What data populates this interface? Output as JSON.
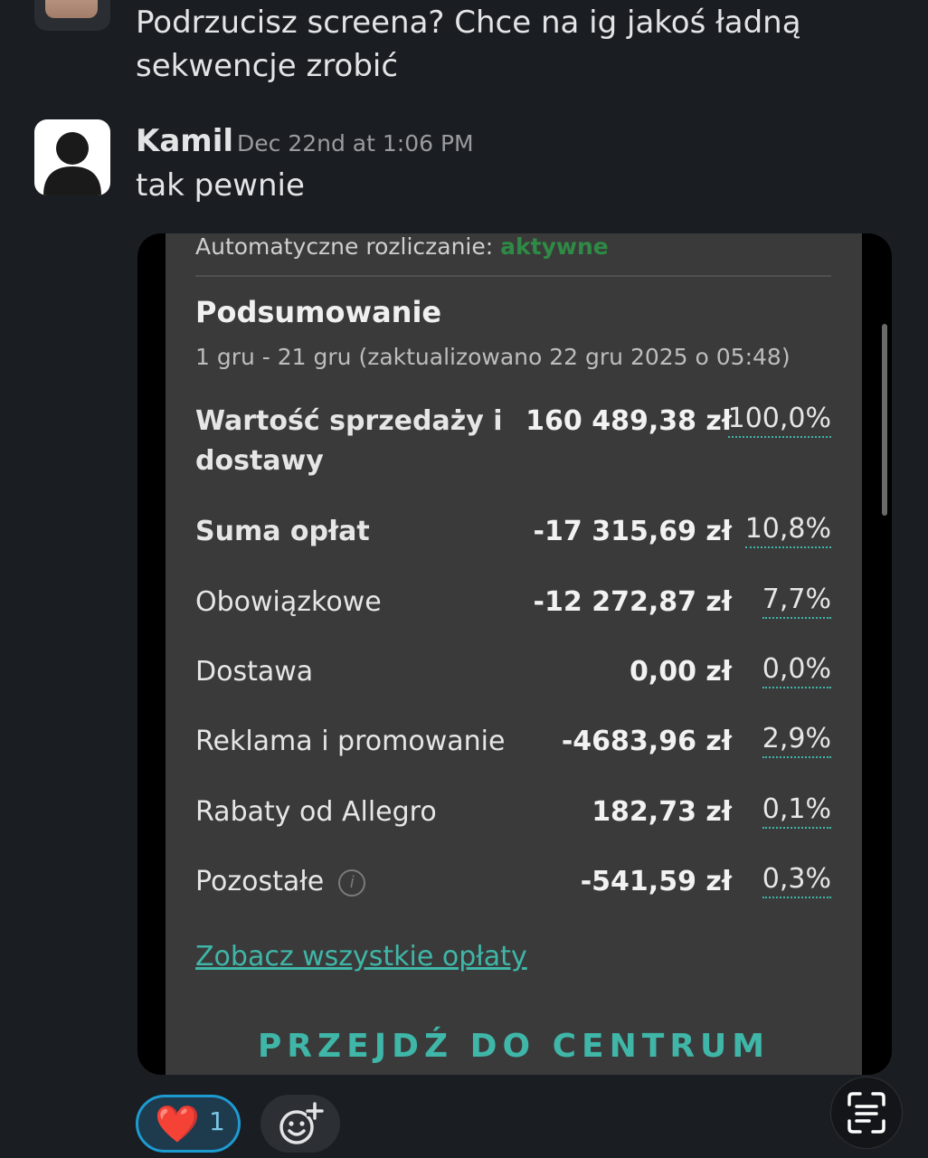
{
  "previous_message": {
    "line1": "Podrzucisz screena? Chce na ig jakoś ładną",
    "line2": "sekwencje zrobić"
  },
  "message": {
    "sender": "Kamil",
    "timestamp": "Dec 22nd at 1:06 PM",
    "text": "tak pewnie"
  },
  "screenshot": {
    "auto_label": "Automatyczne rozliczanie:",
    "auto_status": "aktywne",
    "title": "Podsumowanie",
    "period": "1 gru - 21 gru (zaktualizowano 22 gru 2025 o 05:48)",
    "rows": [
      {
        "label_line1": "Wartość sprzedaży i",
        "label_line2": "dostawy",
        "amount": "160 489,38 zł",
        "pct": "100,0%"
      },
      {
        "label": "Suma opłat",
        "amount": "-17 315,69 zł",
        "pct": "10,8%"
      },
      {
        "label": "Obowiązkowe",
        "amount": "-12 272,87 zł",
        "pct": "7,7%"
      },
      {
        "label": "Dostawa",
        "amount": "0,00 zł",
        "pct": "0,0%"
      },
      {
        "label": "Reklama i promowanie",
        "amount": "-4683,96 zł",
        "pct": "2,9%"
      },
      {
        "label": "Rabaty od Allegro",
        "amount": "182,73 zł",
        "pct": "0,1%"
      },
      {
        "label": "Pozostałe",
        "amount": "-541,59 zł",
        "pct": "0,3%"
      }
    ],
    "see_all_link": "Zobacz wszystkie opłaty",
    "cta": "PRZEJDŹ DO CENTRUM"
  },
  "reactions": {
    "heart_emoji": "❤️",
    "heart_count": "1"
  },
  "icons": {
    "info": "info-icon",
    "add_reaction": "add-reaction-icon",
    "scan": "text-scan-icon"
  },
  "colors": {
    "accent_green": "#2e8a45",
    "link_teal": "#3fb6a8",
    "reaction_border": "#1d9bd1"
  }
}
